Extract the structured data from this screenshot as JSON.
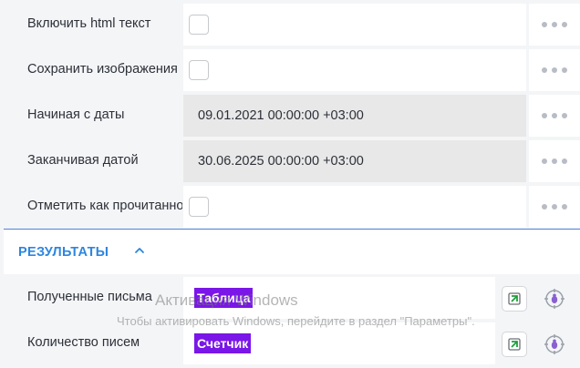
{
  "properties": [
    {
      "label": "Включить html текст",
      "type": "checkbox"
    },
    {
      "label": "Сохранить изображения",
      "type": "checkbox"
    },
    {
      "label": "Начиная с даты",
      "type": "date",
      "value": "09.01.2021 00:00:00 +03:00"
    },
    {
      "label": "Заканчивая датой",
      "type": "date",
      "value": "30.06.2025 00:00:00 +03:00"
    },
    {
      "label": "Отметить как прочитанное",
      "type": "checkbox"
    }
  ],
  "results_section": {
    "title": "РЕЗУЛЬТАТЫ",
    "chevron_icon": "chevron-up-icon",
    "accent": "#2e86de"
  },
  "outputs": [
    {
      "label": "Полученные письма",
      "variable": "Таблица"
    },
    {
      "label": "Количество писем",
      "variable": "Счетчик"
    }
  ],
  "tag_color": "#7a16e8",
  "watermark": {
    "line1": "Активация Windows",
    "line2": "Чтобы активировать Windows, перейдите в раздел \"Параметры\"."
  }
}
